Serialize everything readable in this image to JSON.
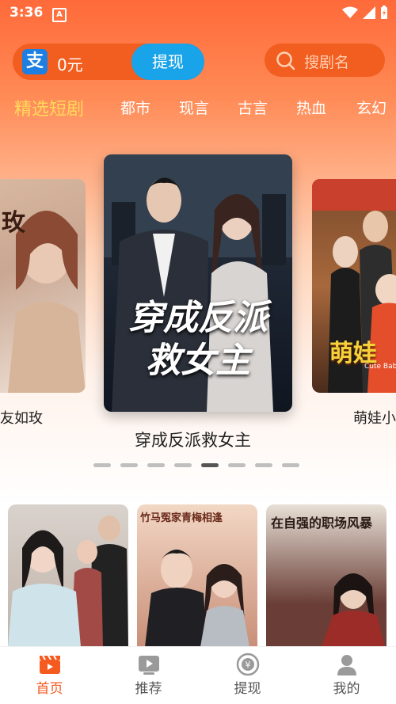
{
  "status": {
    "time": "3:36",
    "app_letter": "A"
  },
  "wallet": {
    "balance": "0元",
    "withdraw_label": "提现",
    "pay_icon_glyph": "支"
  },
  "search": {
    "placeholder": "搜剧名"
  },
  "categories": [
    "精选短剧",
    "都市",
    "现言",
    "古言",
    "热血",
    "玄幻"
  ],
  "carousel": {
    "left_caption": "友如玫",
    "center_caption": "穿成反派救女主",
    "right_caption": "萌娃小",
    "center_poster_title": "穿成反派救女主",
    "left_poster_text": "玫",
    "right_poster_text": "萌娃",
    "right_poster_sub": "Cute Bab",
    "dots_total": 8,
    "dots_active_index": 4
  },
  "grid": [
    {
      "poster_text": ""
    },
    {
      "poster_text": "竹马冤家青梅相逢"
    },
    {
      "poster_text": "在自强的职场风暴"
    }
  ],
  "tabs": [
    {
      "label": "首页",
      "icon": "clapper-icon",
      "active": true
    },
    {
      "label": "推荐",
      "icon": "play-icon",
      "active": false
    },
    {
      "label": "提现",
      "icon": "yen-coin-icon",
      "active": false
    },
    {
      "label": "我的",
      "icon": "user-icon",
      "active": false
    }
  ],
  "colors": {
    "accent": "#f55a1f",
    "active_category": "#ffd95a",
    "withdraw_button": "#19a3e8"
  }
}
